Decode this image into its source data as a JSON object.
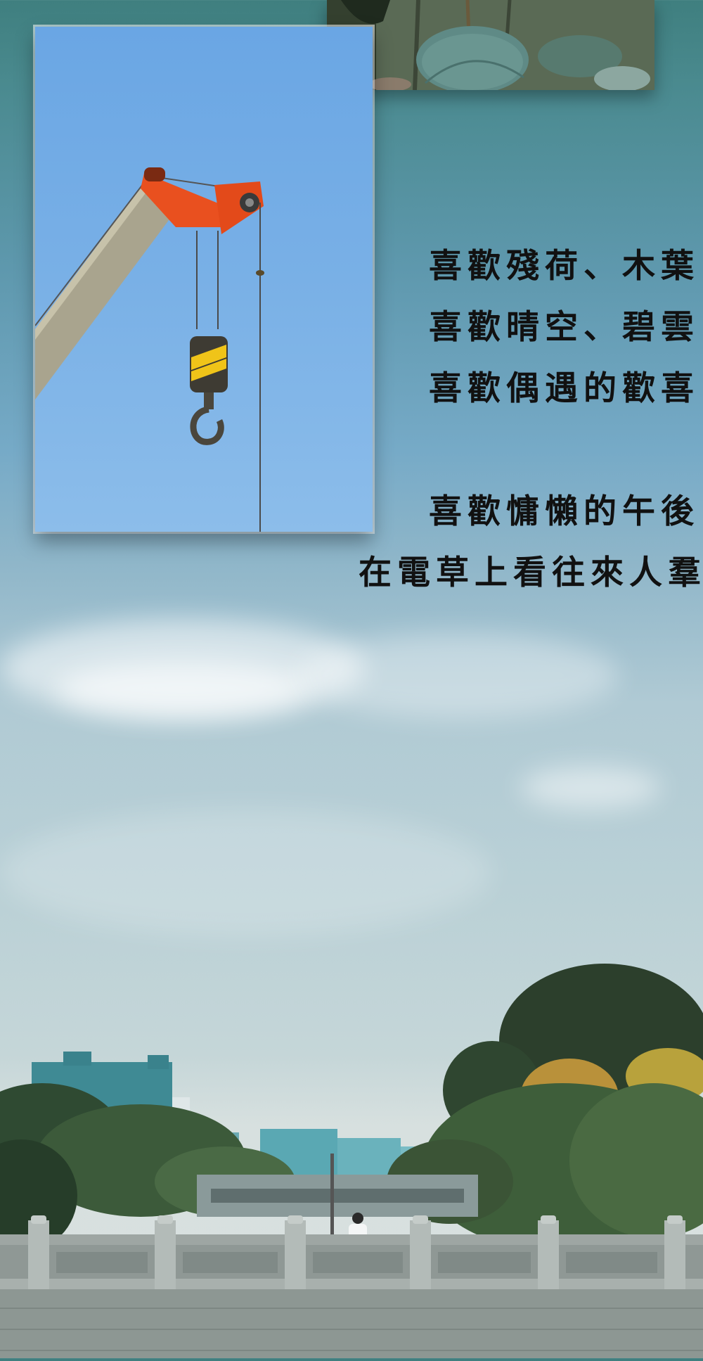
{
  "poem": {
    "lines_1": [
      "喜歡殘荷、木葉",
      "喜歡晴空、碧雲",
      "喜歡偶遇的歡喜"
    ],
    "lines_2": [
      "喜歡慵懶的午後",
      "在電草上看往來人羣"
    ]
  },
  "colors": {
    "sky_top": "#3f7f7f",
    "sky_mid": "#76aac7",
    "sky_low": "#c5d6d8",
    "crane_sky": "#6aa6e4",
    "crane_arm_orange": "#e9501f",
    "boom_gray": "#a9a48e",
    "text": "#111111"
  },
  "icons": {
    "crane": "crane-hook-photo",
    "lotus": "lotus-leaf-photo",
    "bridge": "stone-bridge-railing"
  }
}
